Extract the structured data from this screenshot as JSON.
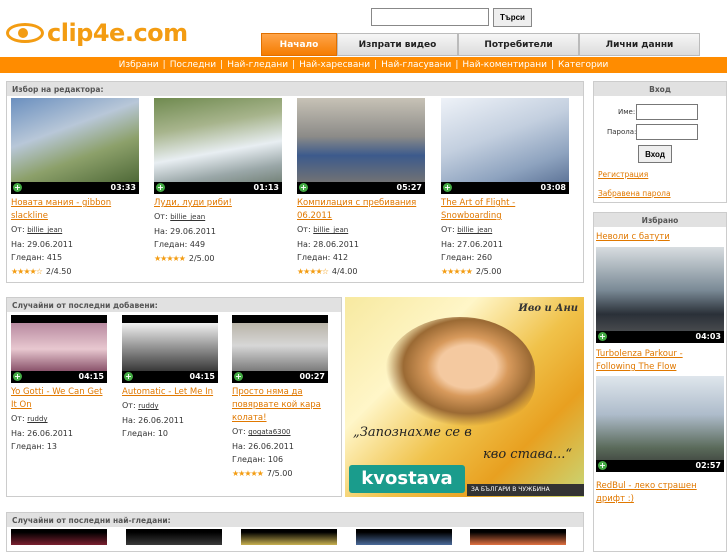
{
  "logo": {
    "text": "clip4e.com"
  },
  "search": {
    "button": "Търси",
    "value": ""
  },
  "tabs": [
    "Начало",
    "Изпрати видео",
    "Потребители",
    "Лични данни"
  ],
  "subnav": [
    "Избрани",
    "Последни",
    "Най-гледани",
    "Най-харесвани",
    "Най-гласувани",
    "Най-коментирани",
    "Категории"
  ],
  "editor": {
    "heading": "Избор на редактора:",
    "videos": [
      {
        "title": "Новата мания - gibbon slackline",
        "by": "От:",
        "user": "billie_jean",
        "date": "На: 29.06.2011",
        "views": "Гледан: 415",
        "rating": "2/4.50",
        "stars": "★★★★☆",
        "duration": "03:33"
      },
      {
        "title": "Луди, луди риби!",
        "by": "От:",
        "user": "billie_jean",
        "date": "На: 29.06.2011",
        "views": "Гледан: 449",
        "rating": "2/5.00",
        "stars": "★★★★★",
        "duration": "01:13"
      },
      {
        "title": "Компилация с пребивания 06.2011",
        "by": "От:",
        "user": "billie_jean",
        "date": "На: 28.06.2011",
        "views": "Гледан: 412",
        "rating": "4/4.00",
        "stars": "★★★★☆",
        "duration": "05:27"
      },
      {
        "title": "The Art of Flight - Snowboarding",
        "by": "От:",
        "user": "billie_jean",
        "date": "На: 27.06.2011",
        "views": "Гледан: 260",
        "rating": "2/5.00",
        "stars": "★★★★★",
        "duration": "03:08"
      }
    ]
  },
  "random_new": {
    "heading": "Случайни от последни добавени:",
    "videos": [
      {
        "title": "Yo Gotti - We Can Get It On",
        "by": "От:",
        "user": "ruddy",
        "date": "На: 26.06.2011",
        "views": "Гледан: 13",
        "duration": "04:15"
      },
      {
        "title": "Automatic - Let Me In",
        "by": "От:",
        "user": "ruddy",
        "date": "На: 26.06.2011",
        "views": "Гледан: 10",
        "duration": "04:15"
      },
      {
        "title": "Просто няма да повярвате кой кара колата!",
        "by": "От:",
        "user": "gogata6300",
        "date": "На: 26.06.2011",
        "views": "Гледан: 106",
        "rating": "7/5.00",
        "stars": "★★★★★",
        "duration": "00:27"
      }
    ]
  },
  "ad": {
    "corner": "Иво и Ани",
    "slogan1": "„Запознахме се в",
    "slogan2": "кво става...“",
    "brand": "kvostava",
    "tagline": "ЗА БЪЛГАРИ В ЧУЖБИНА"
  },
  "random_viewed": {
    "heading": "Случайни от последни най-гледани:"
  },
  "login": {
    "heading": "Вход",
    "user_label": "Име:",
    "pass_label": "Парола:",
    "button": "Вход",
    "register": "Регистрация",
    "forgot": "Забравена парола"
  },
  "featured": {
    "heading": "Избрано",
    "videos": [
      {
        "title": "Неволи с батути",
        "duration": "04:03"
      },
      {
        "title": "Turbolenza Parkour - Following The Flow",
        "duration": "02:57"
      },
      {
        "title": "RedBul - леко страшен дрифт :)"
      }
    ]
  }
}
